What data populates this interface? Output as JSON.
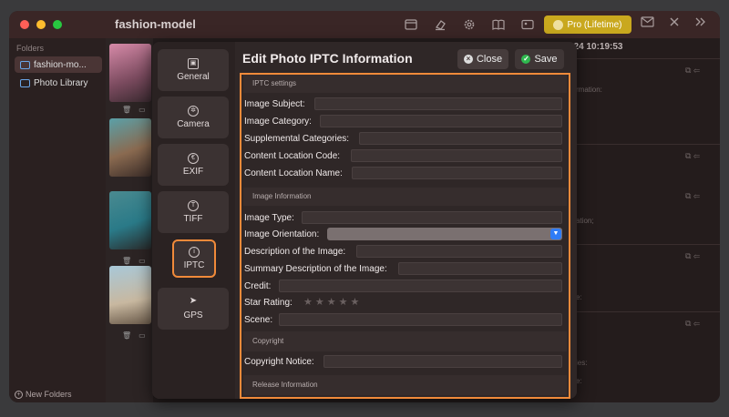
{
  "app": {
    "title": "fashion-model",
    "pro_label": "Pro (Lifetime)",
    "toolbar_icons": [
      "panel-icon",
      "eraser-icon",
      "settings-gear-icon",
      "book-icon",
      "photo-card-icon"
    ],
    "right_icons": [
      "mail-icon",
      "close-x-icon",
      "chevron-double-right-icon"
    ]
  },
  "sidebar": {
    "header": "Folders",
    "items": [
      {
        "label": "fashion-mo...",
        "active": true
      },
      {
        "label": "Photo Library",
        "active": false
      }
    ],
    "new_folders": "New Folders"
  },
  "background": {
    "date_fragment": "024 10:19:53",
    "fragments": [
      "rmation:",
      "ation;",
      "e:",
      "ies:",
      "e:"
    ]
  },
  "dialog": {
    "title": "Edit Photo IPTC Information",
    "close_label": "Close",
    "save_label": "Save",
    "nav": [
      {
        "id": "general",
        "label": "General",
        "icon": "image-icon",
        "glyph": "▣"
      },
      {
        "id": "camera",
        "label": "Camera",
        "icon": "aperture-icon",
        "glyph": "✲"
      },
      {
        "id": "exif",
        "label": "EXIF",
        "icon": "exif-icon",
        "glyph": "€"
      },
      {
        "id": "tiff",
        "label": "TIFF",
        "icon": "tiff-icon",
        "glyph": "T"
      },
      {
        "id": "iptc",
        "label": "IPTC",
        "icon": "info-icon",
        "glyph": "i",
        "active": true
      },
      {
        "id": "gps",
        "label": "GPS",
        "icon": "location-arrow-icon",
        "glyph": "➤"
      }
    ],
    "sections": {
      "iptc_settings": "IPTC settings",
      "image_information": "Image Information",
      "copyright": "Copyright",
      "release_information": "Release Information"
    },
    "fields": {
      "image_subject": {
        "label": "Image Subject:",
        "value": ""
      },
      "image_category": {
        "label": "Image Category:",
        "value": ""
      },
      "supplemental_categories": {
        "label": "Supplemental Categories:",
        "value": ""
      },
      "content_location_code": {
        "label": "Content Location Code:",
        "value": ""
      },
      "content_location_name": {
        "label": "Content Location Name:",
        "value": ""
      },
      "image_type": {
        "label": "Image Type:",
        "value": ""
      },
      "image_orientation": {
        "label": "Image Orientation:",
        "value": ""
      },
      "description": {
        "label": "Description of the Image:",
        "value": ""
      },
      "summary_description": {
        "label": "Summary Description of the Image:",
        "value": ""
      },
      "credit": {
        "label": "Credit:",
        "value": ""
      },
      "star_rating": {
        "label": "Star Rating:",
        "value": 0,
        "max": 5
      },
      "scene": {
        "label": "Scene:",
        "value": ""
      },
      "copyright_notice": {
        "label": "Copyright Notice:",
        "value": ""
      }
    },
    "accent_color": "#f08a3a"
  }
}
